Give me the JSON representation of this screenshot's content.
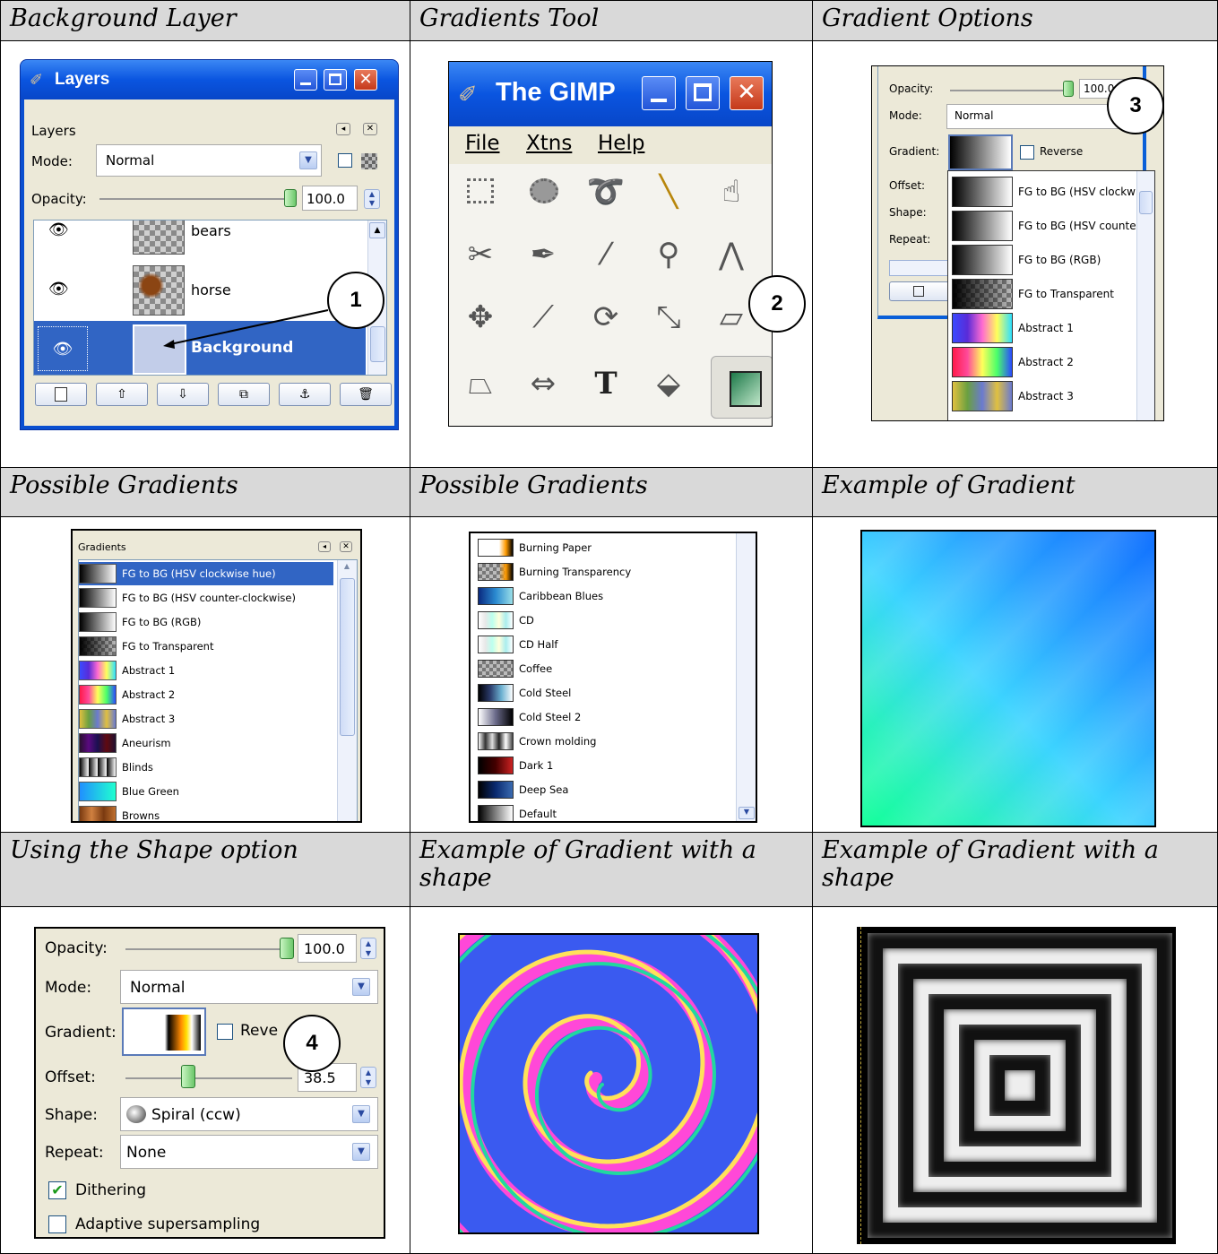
{
  "headers": {
    "row1": [
      "Background Layer",
      "Gradients Tool",
      "Gradient Options"
    ],
    "row2": [
      "Possible Gradients",
      "Possible Gradients",
      "Example of Gradient"
    ],
    "row3": [
      "Using the Shape option",
      "Example of Gradient with a shape",
      "Example of Gradient with a shape"
    ]
  },
  "layers": {
    "title": "Layers",
    "section": "Layers",
    "mode_label": "Mode:",
    "mode_value": "Normal",
    "opacity_label": "Opacity:",
    "opacity_value": "100.0",
    "items": [
      {
        "name": "bears"
      },
      {
        "name": "horse"
      },
      {
        "name": "Background"
      }
    ]
  },
  "gimp": {
    "title": "The GIMP",
    "menu": [
      "File",
      "Xtns",
      "Help"
    ]
  },
  "gradient_options": {
    "opacity_label": "Opacity:",
    "opacity_value": "100.0",
    "mode_label": "Mode:",
    "mode_value": "Normal",
    "gradient_label": "Gradient:",
    "reverse_label": "Reverse",
    "offset_label": "Offset:",
    "shape_label": "Shape:",
    "repeat_label": "Repeat:",
    "items": [
      "FG to BG (HSV clockw",
      "FG to BG (HSV counte",
      "FG to BG (RGB)",
      "FG to Transparent",
      "Abstract 1",
      "Abstract 2",
      "Abstract 3"
    ]
  },
  "gradients_list1": {
    "title": "Gradients",
    "items": [
      "FG to BG (HSV clockwise hue)",
      "FG to BG (HSV counter-clockwise)",
      "FG to BG (RGB)",
      "FG to Transparent",
      "Abstract 1",
      "Abstract 2",
      "Abstract 3",
      "Aneurism",
      "Blinds",
      "Blue Green",
      "Browns"
    ]
  },
  "gradients_list2": {
    "items": [
      "Burning Paper",
      "Burning Transparency",
      "Caribbean Blues",
      "CD",
      "CD Half",
      "Coffee",
      "Cold Steel",
      "Cold Steel 2",
      "Crown molding",
      "Dark 1",
      "Deep Sea",
      "Default"
    ]
  },
  "shape_options": {
    "opacity_label": "Opacity:",
    "opacity_value": "100.0",
    "mode_label": "Mode:",
    "mode_value": "Normal",
    "gradient_label": "Gradient:",
    "reverse_label": "Reve",
    "offset_label": "Offset:",
    "offset_value": "38.5",
    "shape_label": "Shape:",
    "shape_value": "Spiral (ccw)",
    "repeat_label": "Repeat:",
    "repeat_value": "None",
    "dithering_label": "Dithering",
    "adaptive_label": "Adaptive supersampling"
  },
  "callouts": [
    "1",
    "2",
    "3",
    "4"
  ],
  "colors": {
    "header_bg": "#d9d9d9",
    "xp_blue": "#0a5fd8",
    "selection": "#3165c4"
  }
}
